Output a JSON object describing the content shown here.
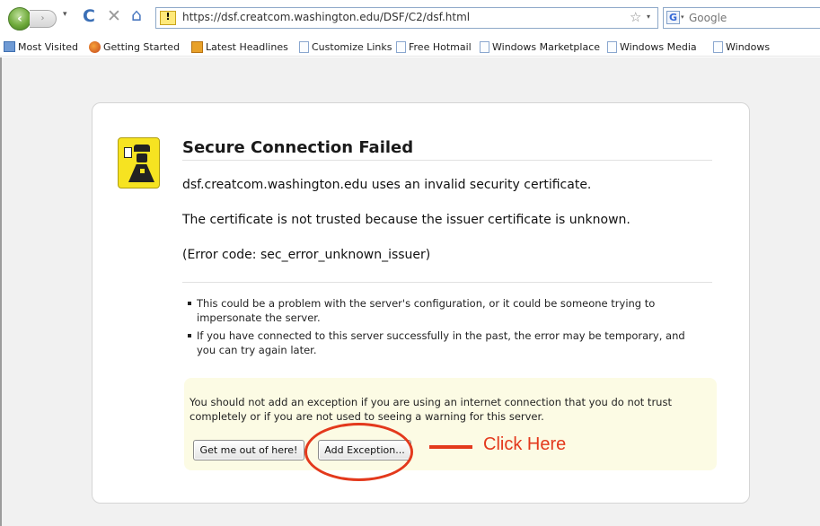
{
  "browser": {
    "url": "https://dsf.creatcom.washington.edu/DSF/C2/dsf.html",
    "search_placeholder": "Google",
    "back_glyph": "‹",
    "forward_glyph": "›",
    "dropdown_glyph": "▾",
    "reload_glyph": "C",
    "stop_glyph": "✕",
    "home_glyph": "⌂",
    "star_glyph": "☆",
    "warning_glyph": "!",
    "google_glyph": "G"
  },
  "bookmarks": [
    {
      "label": "Most Visited",
      "icon": "most-visited-icon"
    },
    {
      "label": "Getting Started",
      "icon": "getting-started-icon"
    },
    {
      "label": "Latest Headlines",
      "icon": "rss-feed-icon"
    },
    {
      "label": "Customize Links",
      "icon": "page-icon"
    },
    {
      "label": "Free Hotmail",
      "icon": "page-icon"
    },
    {
      "label": "Windows Marketplace",
      "icon": "page-icon"
    },
    {
      "label": "Windows Media",
      "icon": "page-icon"
    },
    {
      "label": "Windows",
      "icon": "page-icon"
    }
  ],
  "error": {
    "title": "Secure Connection Failed",
    "short_desc": "dsf.creatcom.washington.edu uses an invalid security certificate.",
    "tech_info": "The certificate is not trusted because the issuer certificate is unknown.",
    "error_code": "(Error code: sec_error_unknown_issuer)",
    "bullets": [
      "This could be a problem with the server's configuration, or it could be someone trying to impersonate the server.",
      "If you have connected to this server successfully in the past, the error may be temporary, and you can try again later."
    ],
    "warning_text": "You should not add an exception if you are using an internet connection that you do not trust completely or if you are not used to seeing a warning for this server.",
    "get_out_label": "Get me out of here!",
    "add_exception_label": "Add Exception..."
  },
  "annotation": {
    "label": "Click Here",
    "color": "#e3391c"
  },
  "colors": {
    "page_background": "#f1f1f1",
    "warning_panel": "#fcfbe4",
    "icon_yellow": "#f6e321"
  }
}
